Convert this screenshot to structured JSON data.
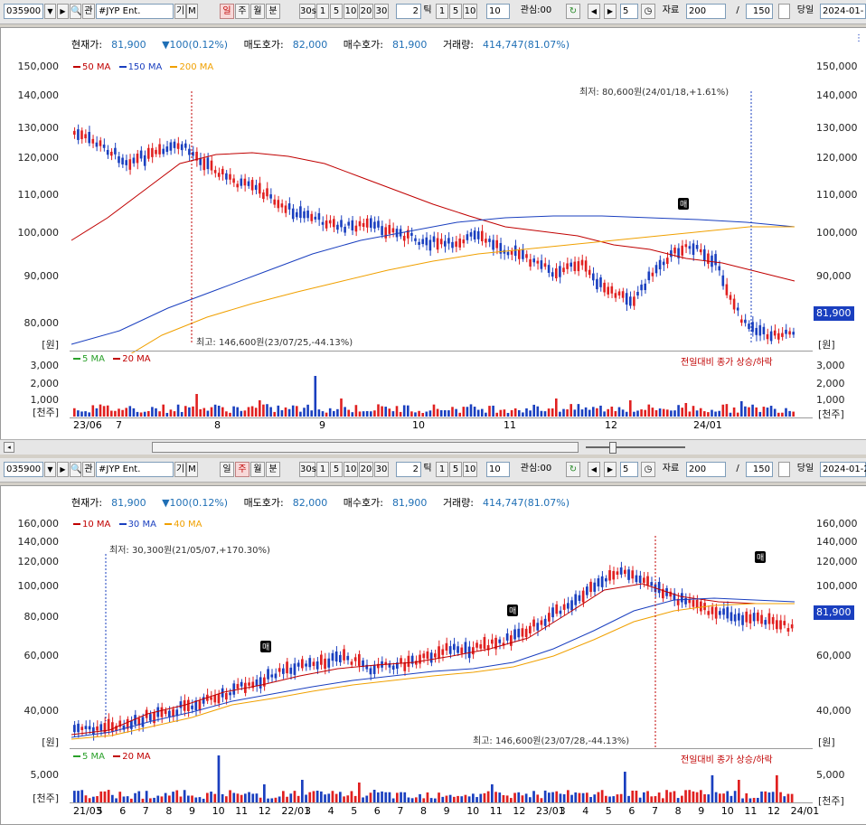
{
  "panes": [
    {
      "toolbar": {
        "code": "035900",
        "name": "#JYP Ent.",
        "gi": "기",
        "m": "M",
        "periods": [
          "일",
          "주",
          "월",
          "분"
        ],
        "selected_period": "일",
        "secs": [
          "30s",
          "1",
          "5",
          "10",
          "20",
          "30"
        ],
        "tick_count": "2",
        "tick_label": "틱",
        "tick_options": [
          "1",
          "5",
          "10"
        ],
        "tick_sel": "10",
        "watch_label": "관심:00",
        "step_value": "5",
        "data_label": "자료",
        "data_count": "200",
        "slash": "/",
        "view_count": "150",
        "today_label": "당일",
        "date": "2024-01-"
      },
      "info": {
        "cur_label": "현재가:",
        "cur_value": "81,900",
        "change": "▼100(0.12%)",
        "ask_label": "매도호가:",
        "ask_value": "82,000",
        "bid_label": "매수호가:",
        "bid_value": "81,900",
        "vol_label": "거래량:",
        "vol_value": "414,747(81.07%)"
      },
      "legend": [
        {
          "label": "50 MA",
          "color": "#c00000"
        },
        {
          "label": "150 MA",
          "color": "#1a3fbf"
        },
        {
          "label": "200 MA",
          "color": "#f0a000"
        }
      ],
      "y_ticks": [
        "150,000",
        "140,000",
        "130,000",
        "120,000",
        "110,000",
        "100,000",
        "90,000",
        "80,000"
      ],
      "unit": "[원]",
      "vol_legend": [
        {
          "label": "5 MA",
          "color": "#2aa02a"
        },
        {
          "label": "20 MA",
          "color": "#c00000"
        }
      ],
      "vol_ticks": [
        "3,000",
        "2,000",
        "1,000"
      ],
      "vol_unit": "[천주]",
      "vol_note": "전일대비 종가 상승/하락",
      "low_note": "최저: 80,600원(24/01/18,+1.61%)",
      "high_note": "최고: 146,600원(23/07/25,-44.13%)",
      "price_tag": "81,900",
      "buy_badge": "매",
      "x_labels": [
        "23/06",
        "7",
        "8",
        "9",
        "10",
        "11",
        "12",
        "24/01"
      ]
    },
    {
      "toolbar": {
        "code": "035900",
        "name": "#JYP Ent.",
        "gi": "기",
        "m": "M",
        "periods": [
          "일",
          "주",
          "월",
          "분"
        ],
        "selected_period": "주",
        "secs": [
          "30s",
          "1",
          "5",
          "10",
          "20",
          "30"
        ],
        "tick_count": "2",
        "tick_label": "틱",
        "tick_options": [
          "1",
          "5",
          "10"
        ],
        "tick_sel": "10",
        "watch_label": "관심:00",
        "step_value": "5",
        "data_label": "자료",
        "data_count": "200",
        "slash": "/",
        "view_count": "150",
        "today_label": "당일",
        "date": "2024-01-2"
      },
      "info": {
        "cur_label": "현재가:",
        "cur_value": "81,900",
        "change": "▼100(0.12%)",
        "ask_label": "매도호가:",
        "ask_value": "82,000",
        "bid_label": "매수호가:",
        "bid_value": "81,900",
        "vol_label": "거래량:",
        "vol_value": "414,747(81.07%)"
      },
      "legend": [
        {
          "label": "10 MA",
          "color": "#c00000"
        },
        {
          "label": "30 MA",
          "color": "#1a3fbf"
        },
        {
          "label": "40 MA",
          "color": "#f0a000"
        }
      ],
      "y_ticks": [
        "160,000",
        "140,000",
        "120,000",
        "100,000",
        "80,000",
        "60,000",
        "40,000"
      ],
      "unit": "[원]",
      "vol_legend": [
        {
          "label": "5 MA",
          "color": "#2aa02a"
        },
        {
          "label": "20 MA",
          "color": "#c00000"
        }
      ],
      "vol_ticks": [
        "5,000"
      ],
      "vol_unit": "[천주]",
      "vol_note": "전일대비 종가 상승/하락",
      "low_note": "최저: 30,300원(21/05/07,+170.30%)",
      "high_note": "최고: 146,600원(23/07/28,-44.13%)",
      "price_tag": "81,900",
      "buy_badge": "매",
      "x_labels": [
        "21/03",
        "5",
        "6",
        "7",
        "8",
        "9",
        "10",
        "11",
        "12",
        "22/01",
        "3",
        "4",
        "5",
        "6",
        "7",
        "8",
        "9",
        "10",
        "11",
        "12",
        "23/01",
        "3",
        "4",
        "5",
        "6",
        "7",
        "8",
        "9",
        "10",
        "11",
        "12",
        "24/01"
      ]
    }
  ],
  "colors": {
    "up": "#e02020",
    "down": "#1a3fbf",
    "ma_red": "#c00000",
    "ma_blue": "#1a3fbf",
    "ma_orange": "#f0a000"
  }
}
